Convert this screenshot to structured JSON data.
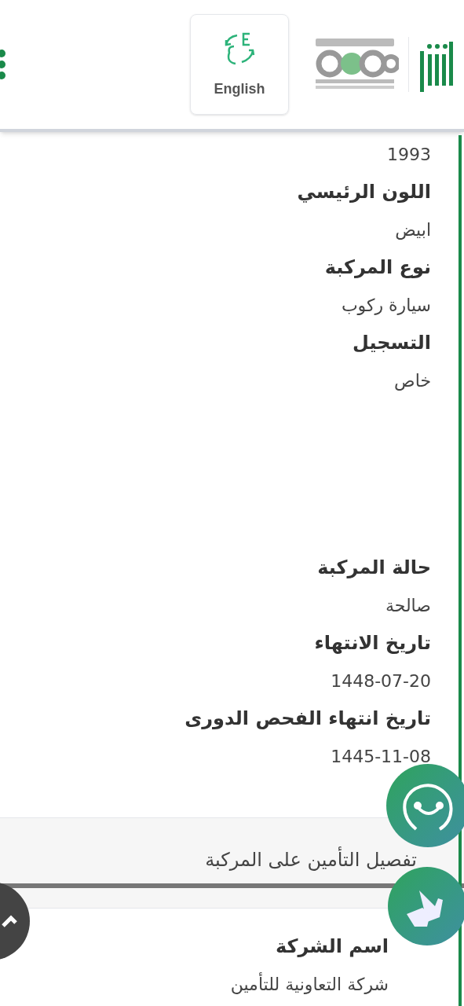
{
  "header": {
    "language_button": "English"
  },
  "details": [
    {
      "kind": "value",
      "text": "1993"
    },
    {
      "kind": "label",
      "text": "اللون الرئيسي"
    },
    {
      "kind": "value",
      "text": "ابيض"
    },
    {
      "kind": "label",
      "text": "نوع المركبة"
    },
    {
      "kind": "value",
      "text": "سيارة ركوب"
    },
    {
      "kind": "label",
      "text": "التسجيل"
    },
    {
      "kind": "value",
      "text": "خاص"
    },
    {
      "kind": "gap"
    },
    {
      "kind": "label",
      "text": "حالة المركبة"
    },
    {
      "kind": "value",
      "text": "صالحة"
    },
    {
      "kind": "label",
      "text": "تاريخ الانتهاء"
    },
    {
      "kind": "value",
      "text": "1448-07-20"
    },
    {
      "kind": "label",
      "text": "تاريخ انتهاء الفحص الدورى"
    },
    {
      "kind": "value",
      "text": "1445-11-08"
    }
  ],
  "insurance": {
    "title": "تفصيل التأمين على المركبة",
    "rows": [
      {
        "kind": "label",
        "text": "اسم الشركة"
      },
      {
        "kind": "value",
        "text": "شركة التعاونية للتأمين"
      }
    ]
  }
}
